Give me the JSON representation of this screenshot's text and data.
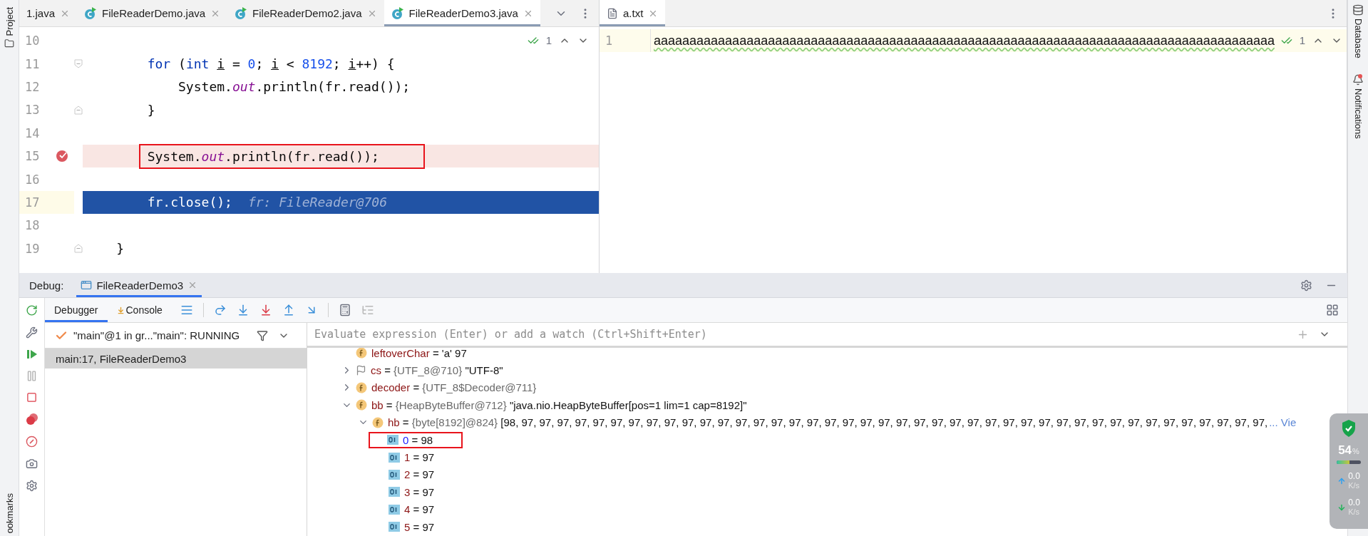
{
  "left_strip": {
    "top_label": "Project",
    "bottom_label": "ookmarks"
  },
  "editor_tabs": [
    {
      "label": "1.java",
      "selected": false
    },
    {
      "label": "FileReaderDemo.java",
      "kind": "java",
      "selected": false
    },
    {
      "label": "FileReaderDemo2.java",
      "kind": "java",
      "selected": false
    },
    {
      "label": "FileReaderDemo3.java",
      "kind": "java",
      "selected": true
    }
  ],
  "editor": {
    "inspection": "1",
    "lines": [
      {
        "number": "10",
        "kind": "code",
        "breakpoint": false,
        "current": false,
        "boxed": false
      },
      {
        "number": "11",
        "kind": "fold-open",
        "breakpoint": false,
        "current": false,
        "boxed": false,
        "tokens": [
          {
            "kind": "keyword",
            "text": "        for"
          },
          {
            "kind": "plain",
            "text": " ("
          },
          {
            "kind": "keyword",
            "text": "int "
          },
          {
            "kind": "var",
            "text": "i"
          },
          {
            "kind": "plain",
            "text": " = "
          },
          {
            "kind": "number",
            "text": "0"
          },
          {
            "kind": "plain",
            "text": "; "
          },
          {
            "kind": "var",
            "text": "i"
          },
          {
            "kind": "plain",
            "text": " < "
          },
          {
            "kind": "number",
            "text": "8192"
          },
          {
            "kind": "plain",
            "text": "; "
          },
          {
            "kind": "var",
            "text": "i"
          },
          {
            "kind": "plain",
            "text": "++) {"
          }
        ]
      },
      {
        "number": "12",
        "kind": "code",
        "breakpoint": false,
        "current": false,
        "boxed": false,
        "tokens": [
          {
            "kind": "plain",
            "text": "            System."
          },
          {
            "kind": "field",
            "text": "out"
          },
          {
            "kind": "plain",
            "text": ".println(fr.read());"
          }
        ]
      },
      {
        "number": "13",
        "kind": "fold-close",
        "breakpoint": false,
        "current": false,
        "boxed": false,
        "tokens": [
          {
            "kind": "plain",
            "text": "        }"
          }
        ]
      },
      {
        "number": "14",
        "kind": "code",
        "breakpoint": false,
        "current": false,
        "boxed": false
      },
      {
        "number": "15",
        "kind": "code",
        "breakpoint": true,
        "current": false,
        "boxed": true,
        "tokens": [
          {
            "kind": "plain",
            "text": "        System."
          },
          {
            "kind": "field",
            "text": "out"
          },
          {
            "kind": "plain",
            "text": ".println(fr.read());"
          }
        ]
      },
      {
        "number": "16",
        "kind": "code",
        "breakpoint": false,
        "current": false,
        "boxed": false
      },
      {
        "number": "17",
        "kind": "code",
        "breakpoint": false,
        "current": true,
        "boxed": false,
        "hint": "fr: FileReader@706",
        "tokens": [
          {
            "kind": "plain",
            "text": "        fr.close();"
          }
        ]
      },
      {
        "number": "18",
        "kind": "code",
        "breakpoint": false,
        "current": false,
        "boxed": false
      },
      {
        "number": "19",
        "kind": "fold-close",
        "breakpoint": false,
        "current": false,
        "boxed": false,
        "tokens": [
          {
            "kind": "plain",
            "text": "    }"
          }
        ]
      }
    ]
  },
  "text_editor": {
    "tab": {
      "label": "a.txt",
      "selected": true
    },
    "inspection": "1",
    "lines": [
      {
        "number": "1",
        "text": "aaaaaaaaaaaaaaaaaaaaaaaaaaaaaaaaaaaaaaaaaaaaaaaaaaaaaaaaaaaaaaaaaaaaaaaaaaaaaaaaaaaaaaa"
      }
    ]
  },
  "right_strip": [
    {
      "label": "Database",
      "kind": "database",
      "badge": false
    },
    {
      "label": "Notifications",
      "kind": "bell",
      "badge": true
    }
  ],
  "debug": {
    "title": "Debug:",
    "session_tab": {
      "label": "FileReaderDemo3",
      "selected": true
    },
    "tabs": [
      {
        "label": "Debugger",
        "kind": "debugger",
        "selected": true
      },
      {
        "label": "Console",
        "kind": "console",
        "selected": false
      }
    ],
    "thread": {
      "label": "\"main\"@1 in gr...\"main\": RUNNING"
    },
    "frames": [
      {
        "label": "main:17, FileReaderDemo3",
        "selected": true
      }
    ],
    "watch": {
      "placeholder": "Evaluate expression (Enter) or add a watch (Ctrl+Shift+Enter)"
    },
    "variables": [
      {
        "kind": "field",
        "name": "leftoverChar",
        "op": "=",
        "value": "'a' 97"
      },
      {
        "kind": "flag",
        "name": "cs",
        "op": "=",
        "type": "{UTF_8@710}",
        "value": "\"UTF-8\"",
        "expanded": false
      },
      {
        "kind": "field",
        "name": "decoder",
        "op": "=",
        "type": "{UTF_8$Decoder@711}",
        "expanded": false
      },
      {
        "kind": "field",
        "name": "bb",
        "op": "=",
        "type": "{HeapByteBuffer@712}",
        "value": "\"java.nio.HeapByteBuffer[pos=1 lim=1 cap=8192]\"",
        "expanded": true,
        "children": [
          {
            "kind": "field",
            "name": "hb",
            "op": "=",
            "type": "{byte[8192]@824}",
            "value": "[98, 97, 97, 97, 97, 97, 97, 97, 97, 97, 97, 97, 97, 97, 97, 97, 97, 97, 97, 97, 97, 97, 97, 97, 97, 97, 97, 97, 97, 97, 97, 97, 97, 97, 97, 97, 97, 97, 97, 97, 97, 97, 97,",
            "link": "... Vie",
            "expanded": true,
            "children": [
              {
                "kind": "element",
                "name": "0",
                "op": "=",
                "value": "98",
                "changed": true,
                "boxed": true
              },
              {
                "kind": "element",
                "name": "1",
                "op": "=",
                "value": "97",
                "changed": false,
                "boxed": false
              },
              {
                "kind": "element",
                "name": "2",
                "op": "=",
                "value": "97",
                "changed": false,
                "boxed": false
              },
              {
                "kind": "element",
                "name": "3",
                "op": "=",
                "value": "97",
                "changed": false,
                "boxed": false
              },
              {
                "kind": "element",
                "name": "4",
                "op": "=",
                "value": "97",
                "changed": false,
                "boxed": false
              },
              {
                "kind": "element",
                "name": "5",
                "op": "=",
                "value": "97",
                "changed": false,
                "boxed": false
              }
            ]
          }
        ]
      }
    ]
  },
  "net_monitor": {
    "load": "54",
    "unit": "%",
    "level": 0.54,
    "rates": [
      {
        "kind": "up",
        "value": "0.0",
        "unit": "K/s"
      },
      {
        "kind": "down",
        "value": "0.0",
        "unit": "K/s"
      }
    ]
  }
}
